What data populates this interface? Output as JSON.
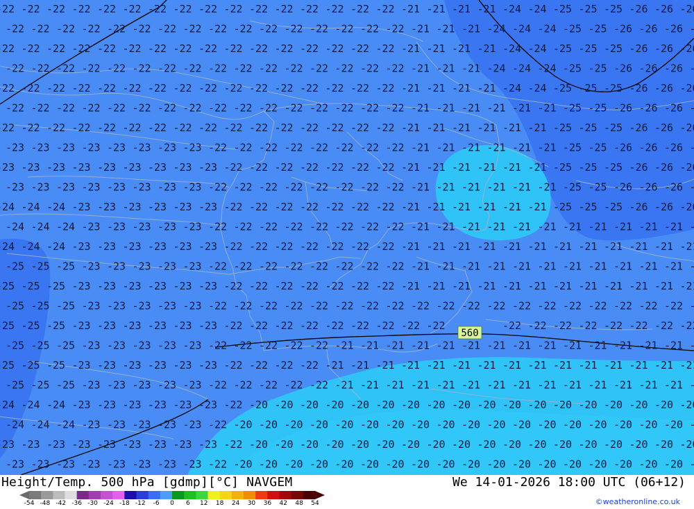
{
  "map": {
    "isoline_label": "560",
    "left_labels": [
      "-25",
      "-24",
      "-23",
      "-22"
    ],
    "right_labels": [
      "-26",
      "-25",
      "-24",
      "-22",
      "-21",
      "-20"
    ],
    "center_labels": [
      "-23",
      "-22",
      "-21",
      "-20"
    ],
    "colors": {
      "dark_zone": "#3a76f2",
      "mid_zone": "#4a8cf5",
      "light_zone": "#2fc3f7",
      "isoline": "#000000",
      "borders": "#9cb2cf",
      "label_box": "#d8f59a"
    }
  },
  "footer": {
    "title": "Height/Temp. 500 hPa [gdmp][°C] NAVGEM",
    "datetime": "We 14-01-2026 18:00 UTC (06+12)",
    "credit": "©weatheronline.co.uk",
    "legend_ticks": [
      "-54",
      "-48",
      "-42",
      "-36",
      "-30",
      "-24",
      "-18",
      "-12",
      "-6",
      "0",
      "6",
      "12",
      "18",
      "24",
      "30",
      "36",
      "42",
      "48",
      "54"
    ],
    "legend_colors": [
      "#7a7a7a",
      "#9a9a9a",
      "#bcbcbc",
      "#dedede",
      "#7b2a8c",
      "#a13db0",
      "#c64fd3",
      "#e45ff0",
      "#1c0fa8",
      "#2a3fd6",
      "#3a6ff2",
      "#4c9ff7",
      "#08991b",
      "#1fbf20",
      "#3ad83a",
      "#f0f020",
      "#f6d418",
      "#f5b010",
      "#f28a0a",
      "#ef3a10",
      "#d01010",
      "#a00808",
      "#780404",
      "#4a0000"
    ]
  }
}
